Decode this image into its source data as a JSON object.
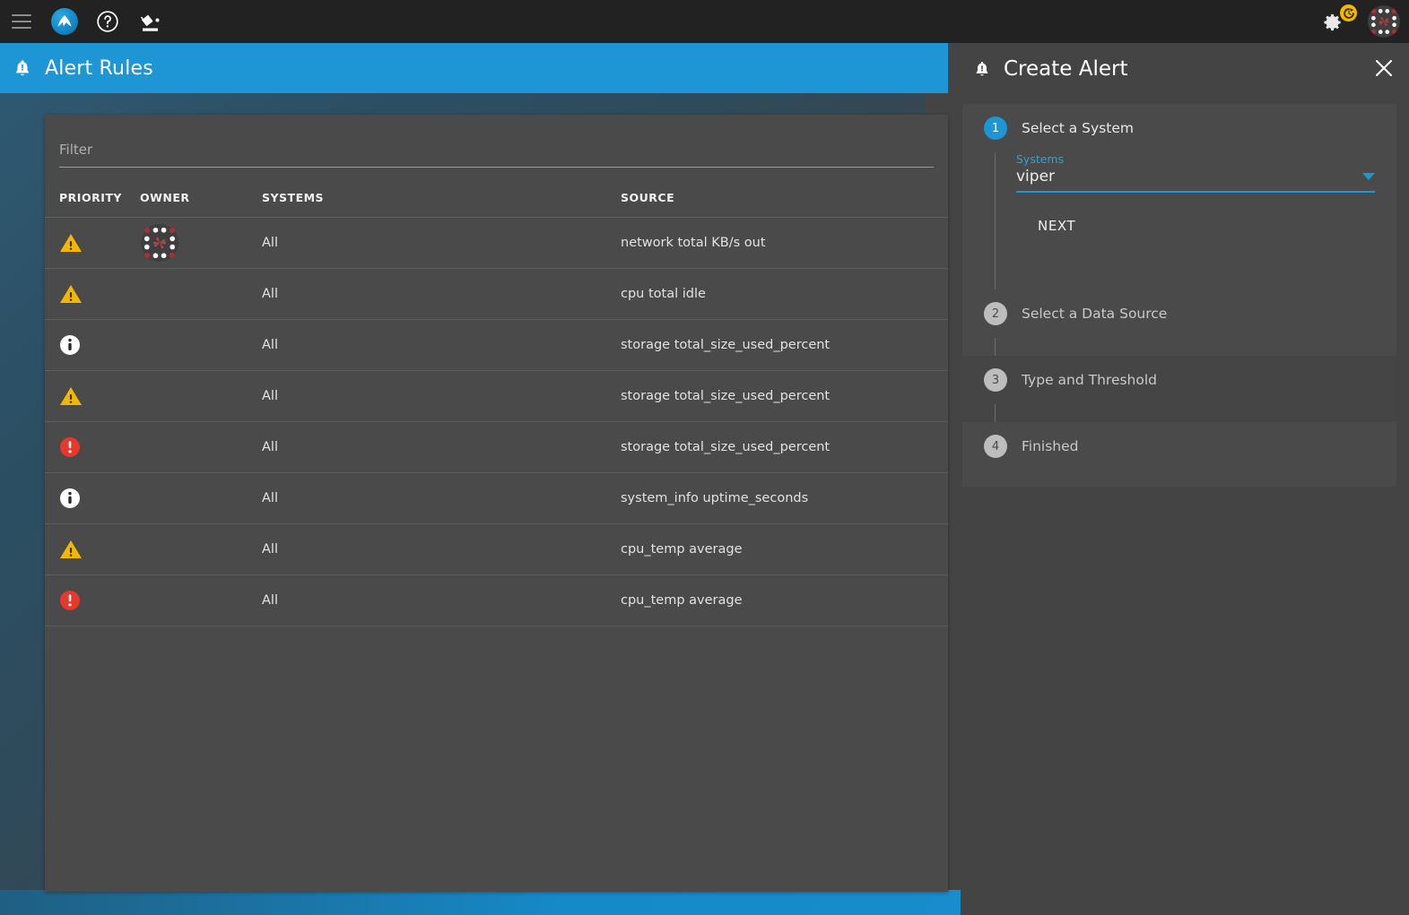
{
  "toolbar": {
    "menu_icon": "hamburger-menu-icon",
    "logo_icon": "app-logo-icon",
    "help_icon": "help-circle-icon",
    "theme_icon": "paint-bucket-icon",
    "settings_icon": "gear-icon",
    "update_badge_icon": "update-clock-icon",
    "avatar_icon": "user-avatar-icon"
  },
  "page_header": {
    "icon": "alert-bell-icon",
    "title": "Alert Rules"
  },
  "filter": {
    "value": "",
    "placeholder": "Filter"
  },
  "table": {
    "columns": [
      "PRIORITY",
      "OWNER",
      "SYSTEMS",
      "SOURCE"
    ],
    "rows": [
      {
        "priority": "warning",
        "owner": "avatar",
        "systems": "All",
        "source": "network total KB/s out"
      },
      {
        "priority": "warning",
        "owner": "",
        "systems": "All",
        "source": "cpu total idle"
      },
      {
        "priority": "info",
        "owner": "",
        "systems": "All",
        "source": "storage total_size_used_percent"
      },
      {
        "priority": "warning",
        "owner": "",
        "systems": "All",
        "source": "storage total_size_used_percent"
      },
      {
        "priority": "critical",
        "owner": "",
        "systems": "All",
        "source": "storage total_size_used_percent"
      },
      {
        "priority": "info",
        "owner": "",
        "systems": "All",
        "source": "system_info uptime_seconds"
      },
      {
        "priority": "warning",
        "owner": "",
        "systems": "All",
        "source": "cpu_temp average"
      },
      {
        "priority": "critical",
        "owner": "",
        "systems": "All",
        "source": "cpu_temp average"
      }
    ]
  },
  "drawer": {
    "icon": "alert-bell-icon",
    "title": "Create Alert",
    "close_icon": "close-icon",
    "steps": [
      {
        "number": "1",
        "label": "Select a System",
        "state": "active"
      },
      {
        "number": "2",
        "label": "Select a Data Source",
        "state": "idle"
      },
      {
        "number": "3",
        "label": "Type and Threshold",
        "state": "idle"
      },
      {
        "number": "4",
        "label": "Finished",
        "state": "idle"
      }
    ],
    "systems_field": {
      "label": "Systems",
      "value": "viper",
      "caret_icon": "chevron-down-icon"
    },
    "next_label": "NEXT"
  },
  "colors": {
    "accent_blue": "#1e95d4",
    "warning_amber": "#f2b705",
    "critical_red": "#e8382c",
    "info_white": "#ffffff",
    "badge_yellow": "#f5b800",
    "card_bg": "#4a4a4a",
    "toolbar_bg": "#222222"
  }
}
